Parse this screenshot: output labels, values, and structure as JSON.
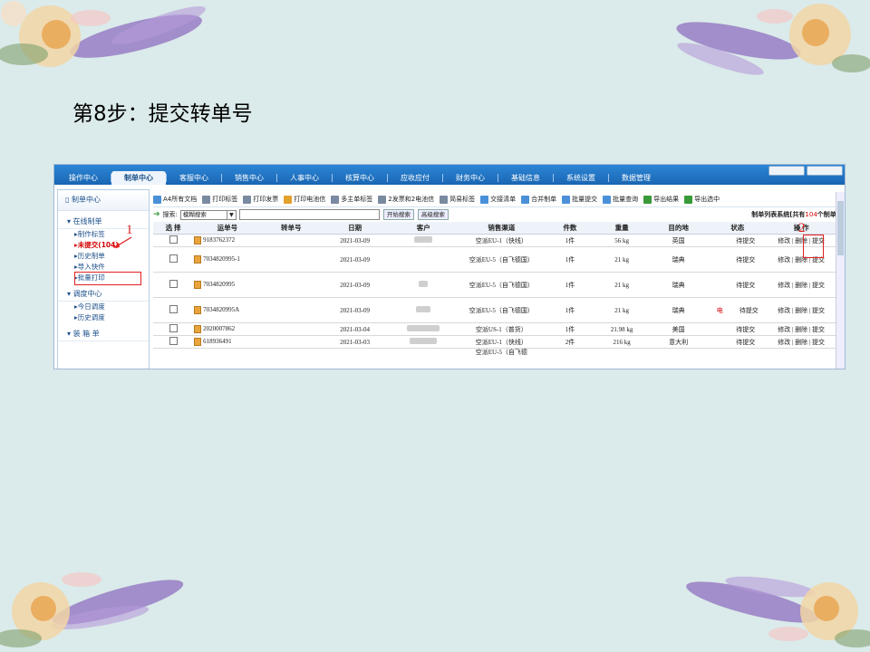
{
  "slide": {
    "title": "第8步：提交转单号"
  },
  "nav": {
    "items": [
      "操作中心",
      "制单中心",
      "客服中心",
      "销售中心",
      "人事中心",
      "核算中心",
      "应收应付",
      "财务中心",
      "基础信息",
      "系统设置",
      "数据管理"
    ],
    "active_index": 1
  },
  "sidebar": {
    "header": "制单中心",
    "groups": [
      {
        "label": "在线制单",
        "items": [
          "制作标签",
          "未提交(104)",
          "历史制单",
          "导入快件",
          "批量打印"
        ]
      },
      {
        "label": "调度中心",
        "items": [
          "今日调度",
          "历史调度"
        ]
      },
      {
        "label": "装 箱 单",
        "items": []
      }
    ],
    "highlighted": "未提交(104)"
  },
  "toolbar": [
    "A4所有文档",
    "打印标签",
    "打印发票",
    "打印电池信",
    "多主单标签",
    "2发票和2电池信",
    "简易标签",
    "交接清单",
    "合并制单",
    "批量提交",
    "批量查询",
    "导出结果",
    "导出选中"
  ],
  "search": {
    "label": "搜索:",
    "mode": "模糊搜索",
    "value": "",
    "start_button": "开始搜索",
    "advanced_button": "高级搜索",
    "system_prefix": "制单列表系统[共有",
    "count": "104",
    "system_suffix": "个制单]"
  },
  "table": {
    "headers": [
      "选 择",
      "运单号",
      "转单号",
      "日期",
      "客户",
      "销售渠道",
      "件数",
      "重量",
      "目的地",
      "状态",
      "操 作"
    ],
    "rows": [
      {
        "waybill": "9183762372",
        "transfer": "",
        "date": "2021-03-09",
        "channel": "空派EU-1（快线）",
        "pieces": "1件",
        "weight": "56 kg",
        "dest": "英国",
        "flag": "",
        "status": "待提交",
        "ops": "修改 | 删除 | 提交"
      },
      {
        "waybill": "7034820995-1",
        "transfer": "",
        "date": "2021-03-09",
        "channel": "空派EU-5（自飞德国）",
        "pieces": "1件",
        "weight": "21 kg",
        "dest": "瑞典",
        "flag": "",
        "status": "待提交",
        "ops": "修改 | 删除 | 提交"
      },
      {
        "waybill": "7034820995",
        "transfer": "",
        "date": "2021-03-09",
        "channel": "空派EU-5（自飞德国）",
        "pieces": "1件",
        "weight": "21 kg",
        "dest": "瑞典",
        "flag": "",
        "status": "待提交",
        "ops": "修改 | 删除 | 提交"
      },
      {
        "waybill": "7034820995A",
        "transfer": "",
        "date": "2021-03-09",
        "channel": "空派EU-5（自飞德国）",
        "pieces": "1件",
        "weight": "21 kg",
        "dest": "瑞典",
        "flag": "电",
        "status": "待提交",
        "ops": "修改 | 删除 | 提交"
      },
      {
        "waybill": "2020007862",
        "transfer": "",
        "date": "2021-03-04",
        "channel": "空派US-1（普货）",
        "pieces": "1件",
        "weight": "21.98 kg",
        "dest": "美国",
        "flag": "",
        "status": "待提交",
        "ops": "修改 | 删除 | 提交"
      },
      {
        "waybill": "618936491",
        "transfer": "",
        "date": "2021-03-03",
        "channel": "空派EU-1（快线）",
        "pieces": "2件",
        "weight": "216 kg",
        "dest": "意大利",
        "flag": "",
        "status": "待提交",
        "ops": "修改 | 删除 | 提交"
      }
    ],
    "partial_row": "空派EU-5（自飞德"
  },
  "annotations": [
    "1",
    "2"
  ]
}
